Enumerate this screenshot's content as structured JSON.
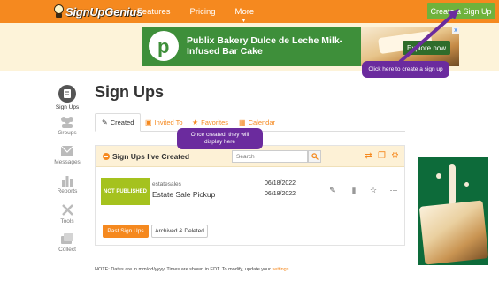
{
  "brand": {
    "name": "SignUpGenius"
  },
  "nav": {
    "links": [
      "Features",
      "Pricing",
      "More"
    ],
    "cta_label": "Create a Sign Up"
  },
  "ad_banner": {
    "logo_letter": "p",
    "headline": "Publix Bakery Dulce de Leche Milk-Infused Bar Cake",
    "button_label": "Explore now",
    "close_label": "x"
  },
  "callouts": {
    "create_tip": "Click here to create a sign up",
    "display_tip": "Once created, they will display here"
  },
  "sidebar": {
    "items": [
      {
        "label": "Sign Ups",
        "icon": "signups-icon"
      },
      {
        "label": "Groups",
        "icon": "groups-icon"
      },
      {
        "label": "Messages",
        "icon": "messages-icon"
      },
      {
        "label": "Reports",
        "icon": "reports-icon"
      },
      {
        "label": "Tools",
        "icon": "tools-icon"
      },
      {
        "label": "Collect",
        "icon": "collect-icon"
      }
    ]
  },
  "main": {
    "title": "Sign Ups",
    "tabs": [
      {
        "label": "Created",
        "icon": "pencil-icon"
      },
      {
        "label": "Invited To",
        "icon": "inbox-icon"
      },
      {
        "label": "Favorites",
        "icon": "star-icon"
      },
      {
        "label": "Calendar",
        "icon": "calendar-icon"
      }
    ]
  },
  "card": {
    "title": "Sign Ups I've Created",
    "search_placeholder": "Search",
    "rows": [
      {
        "status": "NOT PUBLISHED",
        "account": "estatesales",
        "title": "Estate Sale Pickup",
        "date_start": "06/18/2022",
        "date_end": "06/18/2022"
      }
    ],
    "buttons": {
      "past": "Past Sign Ups",
      "archived": "Archived & Deleted"
    }
  },
  "footer_note": {
    "text": "NOTE: Dates are in mm/dd/yyyy. Times are shown in EDT. To modify, update your ",
    "link": "settings",
    "end": "."
  },
  "colors": {
    "brand_orange": "#f5891f",
    "cta_green": "#6fb23c",
    "badge_green": "#a5c21e",
    "callout_purple": "#6b2b9e"
  }
}
